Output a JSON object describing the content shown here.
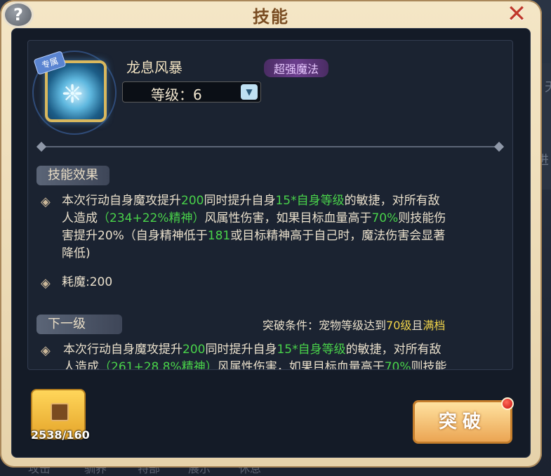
{
  "window": {
    "title": "技能"
  },
  "header": {
    "help_glyph": "?",
    "close_glyph": "✕"
  },
  "skill": {
    "exclusive_tag": "专属",
    "name": "龙息风暴",
    "type": "超强魔法",
    "level_text": "等级：6"
  },
  "effect": {
    "header": "技能效果",
    "line1_parts": [
      "本次行动自身魔攻提升",
      "200",
      "同时提升自身",
      "15*自身等级",
      "的敏捷，对所有敌"
    ],
    "line2_parts": [
      "人造成",
      "（234+22%精神）",
      "风属性伤害，如果目标血量高于",
      "70%",
      "则技能伤"
    ],
    "line3_parts": [
      "害提升20%（自身精神低于",
      "181",
      "或目标精神高于自己时，魔法伤害会显著"
    ],
    "line4": "降低)",
    "mana_cost": "耗魔:200"
  },
  "next_level": {
    "header": "下一级",
    "condition_parts": [
      "突破条件：宠物等级达到",
      "70级",
      "且",
      "满档"
    ],
    "line1_parts": [
      "本次行动自身魔攻提升",
      "200",
      "同时提升自身",
      "15*自身等级",
      "的敏捷，对所有敌"
    ],
    "line2_parts": [
      "人造成",
      "（261+28.8%精神）",
      "风属性伤害，如果目标血量高于",
      "70%",
      "则技能"
    ]
  },
  "item": {
    "count": "2538/160"
  },
  "actions": {
    "breakthrough_label": "突破"
  },
  "background": {
    "right_text_1": "天",
    "right_text_2": "进",
    "footer_tabs": [
      "攻击",
      "驯养",
      "特部",
      "展示",
      "休息"
    ]
  },
  "colors": {
    "highlight_green": "#49d24a",
    "highlight_yellow": "#f1d44a",
    "title_brown": "#7a4d22",
    "close_red": "#c0392b"
  }
}
